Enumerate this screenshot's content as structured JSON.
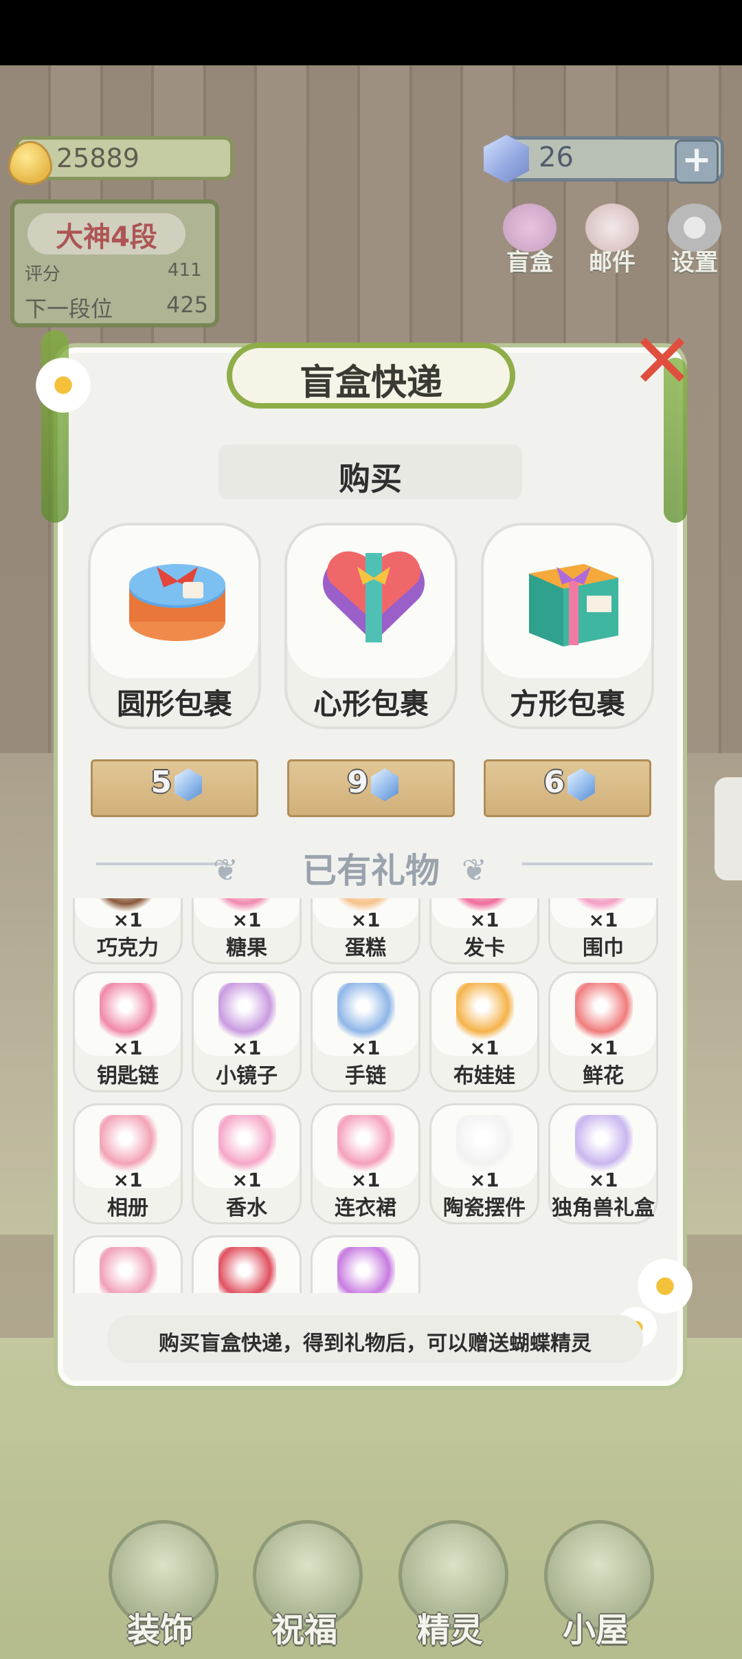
{
  "hud": {
    "coins": "25889",
    "gems": "26",
    "gem_plus": "+",
    "rank": {
      "title": "大神4段",
      "score_label": "评分",
      "score_value": "411",
      "next_label": "下一段位",
      "next_value": "425"
    },
    "top_buttons": [
      {
        "label": "盲盒",
        "icon": "blindbox-icon"
      },
      {
        "label": "邮件",
        "icon": "mail-icon"
      },
      {
        "label": "设置",
        "icon": "gear-icon"
      }
    ]
  },
  "modal": {
    "title": "盲盒快递",
    "close_symbol": "✕",
    "buy_header": "购买",
    "packages": [
      {
        "name": "圆形包裹",
        "price": "5",
        "icon": "round-package-icon"
      },
      {
        "name": "心形包裹",
        "price": "9",
        "icon": "heart-package-icon"
      },
      {
        "name": "方形包裹",
        "price": "6",
        "icon": "square-package-icon"
      }
    ],
    "owned_title": "已有礼物",
    "gifts": [
      {
        "name": "巧克力",
        "count": "×1",
        "color": "#8b5a3c"
      },
      {
        "name": "糖果",
        "count": "×1",
        "color": "#f28bb0"
      },
      {
        "name": "蛋糕",
        "count": "×1",
        "color": "#f6c38c"
      },
      {
        "name": "发卡",
        "count": "×1",
        "color": "#f06d9c"
      },
      {
        "name": "围巾",
        "count": "×1",
        "color": "#f4a0c4"
      },
      {
        "name": "钥匙链",
        "count": "×1",
        "color": "#f08aa8"
      },
      {
        "name": "小镜子",
        "count": "×1",
        "color": "#c99be0"
      },
      {
        "name": "手链",
        "count": "×1",
        "color": "#8fb6e8"
      },
      {
        "name": "布娃娃",
        "count": "×1",
        "color": "#f5b34a"
      },
      {
        "name": "鲜花",
        "count": "×1",
        "color": "#f07c7c"
      },
      {
        "name": "相册",
        "count": "×1",
        "color": "#f3a3b6"
      },
      {
        "name": "香水",
        "count": "×1",
        "color": "#f6a6c8"
      },
      {
        "name": "连衣裙",
        "count": "×1",
        "color": "#f5a0bc"
      },
      {
        "name": "陶瓷摆件",
        "count": "×1",
        "color": "#f2f2f2"
      },
      {
        "name": "独角兽礼盒",
        "count": "×1",
        "color": "#c9b6ef"
      },
      {
        "name": "",
        "count": "",
        "color": "#f0a0b8"
      },
      {
        "name": "",
        "count": "",
        "color": "#e05060"
      },
      {
        "name": "",
        "count": "",
        "color": "#c77be0"
      }
    ],
    "tip": "购买盲盒快递，得到礼物后，可以赠送蝴蝶精灵"
  },
  "bottom_nav": [
    {
      "label": "装饰",
      "icon": "plant-icon"
    },
    {
      "label": "祝福",
      "icon": "butterfly-icon"
    },
    {
      "label": "精灵",
      "icon": "fairy-icon"
    },
    {
      "label": "小屋",
      "icon": "house-icon"
    }
  ]
}
